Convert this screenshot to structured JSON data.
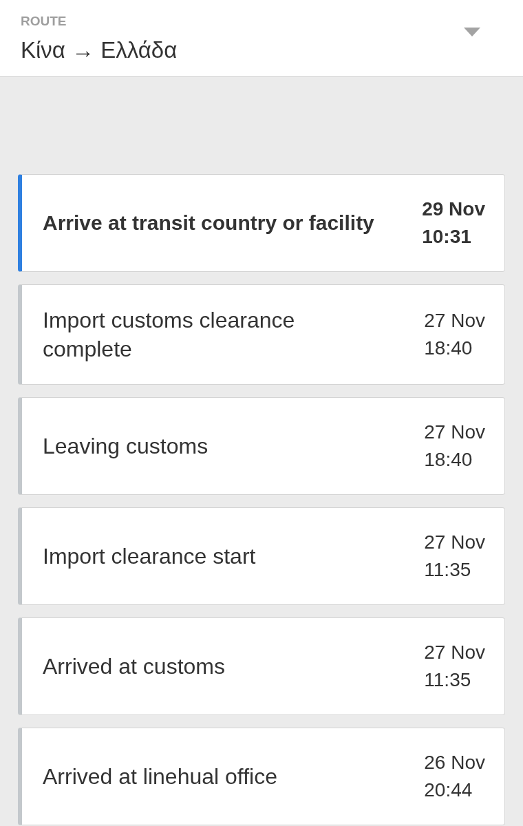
{
  "route": {
    "label": "ROUTE",
    "value": "Κίνα → Ελλάδα"
  },
  "events": [
    {
      "title": "Arrive at transit country or facility",
      "date": "29 Nov",
      "time": "10:31",
      "current": true
    },
    {
      "title": "Import customs clearance complete",
      "date": "27 Nov",
      "time": "18:40",
      "current": false
    },
    {
      "title": "Leaving customs",
      "date": "27 Nov",
      "time": "18:40",
      "current": false
    },
    {
      "title": "Import clearance start",
      "date": "27 Nov",
      "time": "11:35",
      "current": false
    },
    {
      "title": "Arrived at customs",
      "date": "27 Nov",
      "time": "11:35",
      "current": false
    },
    {
      "title": "Arrived at linehual office",
      "date": "26 Nov",
      "time": "20:44",
      "current": false
    }
  ]
}
